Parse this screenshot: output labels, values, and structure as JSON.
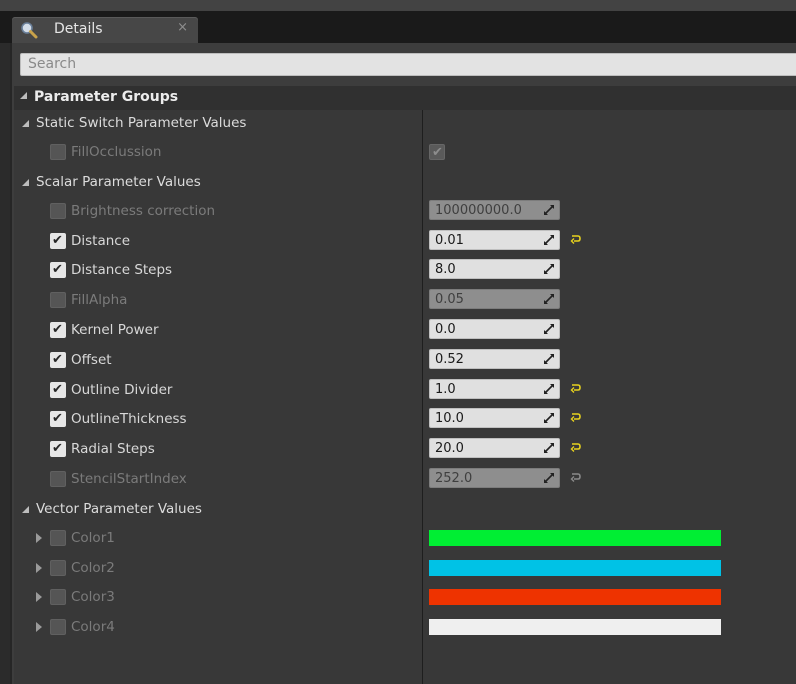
{
  "tab": {
    "title": "Details",
    "close": "×"
  },
  "search": {
    "placeholder": "Search"
  },
  "panel": {
    "group_title": "Parameter Groups"
  },
  "static_switch": {
    "title": "Static Switch Parameter Values",
    "items": [
      {
        "label": "FillOcclussion",
        "enabled": false,
        "value_checked": true
      }
    ]
  },
  "scalar": {
    "title": "Scalar Parameter Values",
    "items": [
      {
        "label": "Brightness correction",
        "enabled": false,
        "value": "100000000.0",
        "reset": false
      },
      {
        "label": "Distance",
        "enabled": true,
        "value": "0.01",
        "reset": true
      },
      {
        "label": "Distance Steps",
        "enabled": true,
        "value": "8.0",
        "reset": false
      },
      {
        "label": "FillAlpha",
        "enabled": false,
        "value": "0.05",
        "reset": false
      },
      {
        "label": "Kernel Power",
        "enabled": true,
        "value": "0.0",
        "reset": false
      },
      {
        "label": "Offset",
        "enabled": true,
        "value": "0.52",
        "reset": false
      },
      {
        "label": "Outline Divider",
        "enabled": true,
        "value": "1.0",
        "reset": true
      },
      {
        "label": "OutlineThickness",
        "enabled": true,
        "value": "10.0",
        "reset": true
      },
      {
        "label": "Radial Steps",
        "enabled": true,
        "value": "20.0",
        "reset": true
      },
      {
        "label": "StencilStartIndex",
        "enabled": false,
        "value": "252.0",
        "reset": true
      }
    ]
  },
  "vector": {
    "title": "Vector Parameter Values",
    "items": [
      {
        "label": "Color1",
        "enabled": false,
        "color": "#00ee33"
      },
      {
        "label": "Color2",
        "enabled": false,
        "color": "#00c2e6"
      },
      {
        "label": "Color3",
        "enabled": false,
        "color": "#ee3300"
      },
      {
        "label": "Color4",
        "enabled": false,
        "color": "#efefef"
      }
    ]
  },
  "colors": {
    "reset_active": "#e8d21d",
    "reset_inactive": "#8a8a8a"
  }
}
